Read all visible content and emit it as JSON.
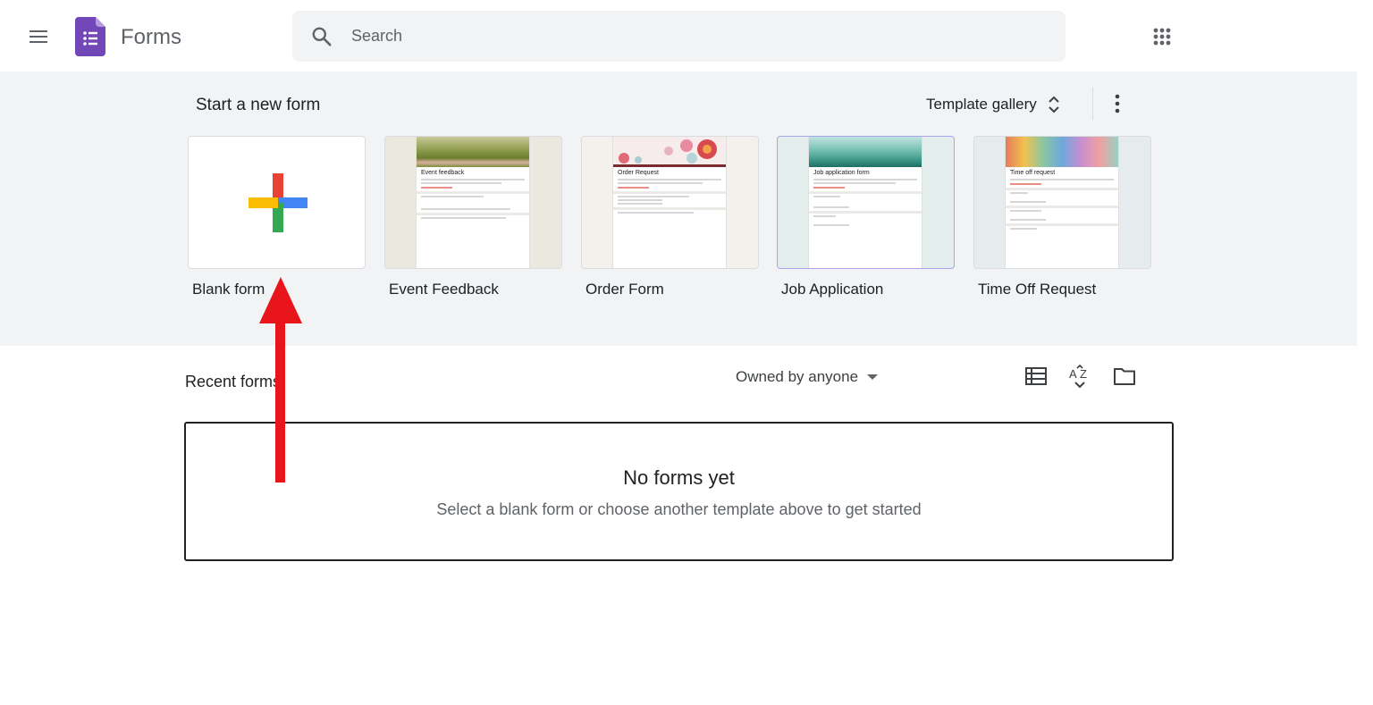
{
  "header": {
    "app_title": "Forms",
    "search_placeholder": "Search",
    "icons": {
      "menu": "hamburger-menu-icon",
      "logo": "forms-logo-icon",
      "search": "search-icon",
      "apps": "apps-grid-icon"
    }
  },
  "templates": {
    "section_title": "Start a new form",
    "gallery_label": "Template gallery",
    "cards": [
      {
        "label": "Blank form"
      },
      {
        "label": "Event Feedback",
        "preview_title": "Event feedback"
      },
      {
        "label": "Order Form",
        "preview_title": "Order Request"
      },
      {
        "label": "Job Application",
        "preview_title": "Job application form"
      },
      {
        "label": "Time Off Request",
        "preview_title": "Time off request"
      }
    ]
  },
  "recent": {
    "title": "Recent forms",
    "owner_filter": "Owned by anyone",
    "empty_title": "No forms yet",
    "empty_subtitle": "Select a blank form or choose another template above to get started"
  },
  "colors": {
    "forms_purple": "#7248b9",
    "band_bg": "#f1f3f4",
    "annotation_arrow": "#e8161b",
    "plus_red": "#ea4335",
    "plus_blue": "#4285f4",
    "plus_green": "#34a853",
    "plus_yellow": "#fbbc04"
  }
}
